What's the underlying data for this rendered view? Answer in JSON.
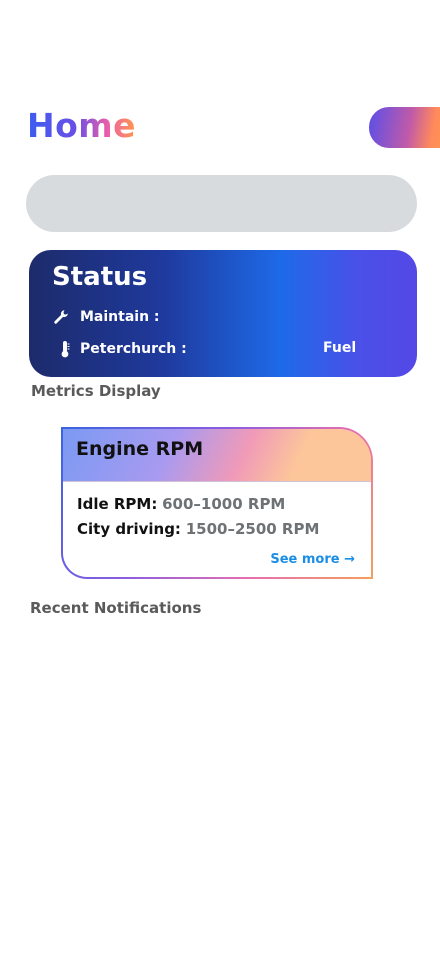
{
  "header": {
    "title": "Home"
  },
  "search": {
    "placeholder": ""
  },
  "status_card": {
    "title": "Status",
    "maintain_label": "Maintain :",
    "location_label": "Peterchurch :",
    "fuel_label": "Fuel",
    "maintain_icon": "wrench-icon",
    "location_icon": "thermometer-icon"
  },
  "sections": {
    "metrics_label": "Metrics Display",
    "notifications_label": "Recent Notifications"
  },
  "metric_card": {
    "title": "Engine RPM",
    "rows": [
      {
        "key": "Idle RPM:",
        "value": "600–1000 RPM"
      },
      {
        "key": "City driving:",
        "value": "1500–2500 RPM"
      }
    ],
    "see_more": "See more →"
  },
  "colors": {
    "status_gradient": [
      "#1d2b6b",
      "#1e6ae8",
      "#5448e6"
    ],
    "link": "#1a8ee6",
    "search_bg": "#d8dbde"
  }
}
